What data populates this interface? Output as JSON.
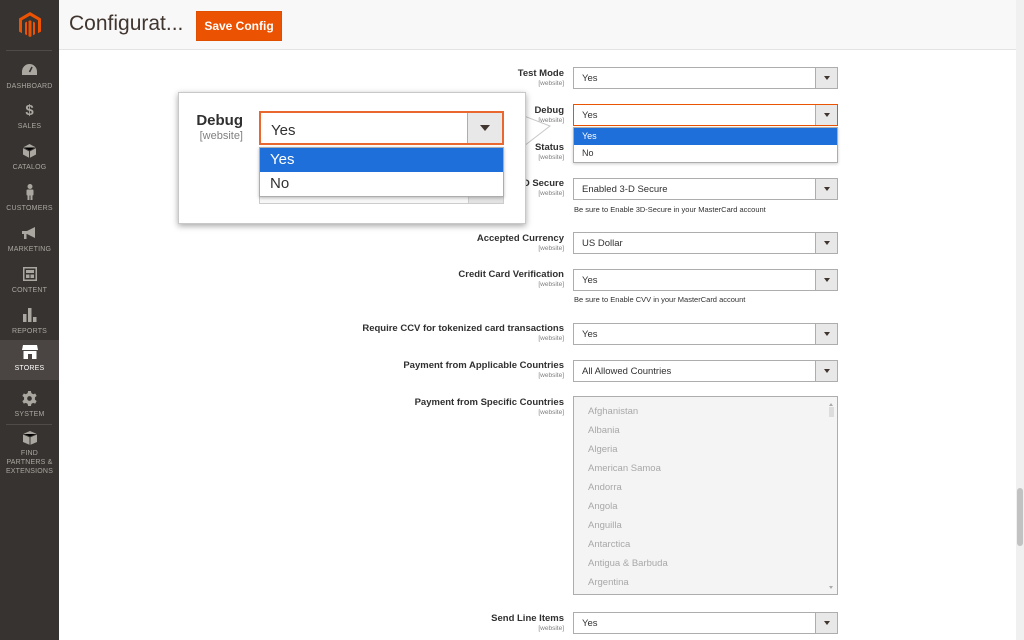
{
  "sidebar": {
    "items": [
      {
        "label": "DASHBOARD",
        "icon": "dashboard-icon"
      },
      {
        "label": "SALES",
        "icon": "dollar-icon"
      },
      {
        "label": "CATALOG",
        "icon": "cube-icon"
      },
      {
        "label": "CUSTOMERS",
        "icon": "person-icon"
      },
      {
        "label": "MARKETING",
        "icon": "megaphone-icon"
      },
      {
        "label": "CONTENT",
        "icon": "layout-icon"
      },
      {
        "label": "REPORTS",
        "icon": "bar-chart-icon"
      },
      {
        "label": "STORES",
        "icon": "storefront-icon"
      },
      {
        "label": "SYSTEM",
        "icon": "gear-icon"
      },
      {
        "label": "FIND PARTNERS & EXTENSIONS",
        "icon": "box-icon"
      }
    ],
    "active": "STORES"
  },
  "header": {
    "title": "Configurat...",
    "save_label": "Save Config"
  },
  "form": {
    "test_mode": {
      "label": "Test Mode",
      "scope": "[website]",
      "value": "Yes"
    },
    "debug": {
      "label": "Debug",
      "scope": "[website]",
      "value": "Yes",
      "options": [
        "Yes",
        "No"
      ],
      "selected_option": "Yes"
    },
    "order_status": {
      "label": "Status",
      "scope": "[website]"
    },
    "secure_3d": {
      "label": "D Secure",
      "scope": "[website]",
      "value": "Enabled 3-D Secure",
      "note": "Be sure to Enable 3D-Secure in your MasterCard account"
    },
    "currency": {
      "label": "Accepted Currency",
      "scope": "[website]",
      "value": "US Dollar"
    },
    "cc_verification": {
      "label": "Credit Card Verification",
      "scope": "[website]",
      "value": "Yes",
      "note": "Be sure to Enable CVV in your MasterCard account"
    },
    "ccv_tokenized": {
      "label": "Require CCV for tokenized card transactions",
      "scope": "[website]",
      "value": "Yes"
    },
    "applicable_countries": {
      "label": "Payment from Applicable Countries",
      "scope": "[website]",
      "value": "All Allowed Countries"
    },
    "specific_countries": {
      "label": "Payment from Specific Countries",
      "scope": "[website]",
      "countries": [
        "Afghanistan",
        "Albania",
        "Algeria",
        "American Samoa",
        "Andorra",
        "Angola",
        "Anguilla",
        "Antarctica",
        "Antigua & Barbuda",
        "Argentina"
      ]
    },
    "send_line_items": {
      "label": "Send Line Items",
      "scope": "[website]",
      "value": "Yes"
    }
  },
  "callout": {
    "label": "Debug",
    "scope": "[website]",
    "value": "Yes",
    "options": [
      "Yes",
      "No"
    ],
    "selected_option": "Yes"
  },
  "colors": {
    "accent": "#eb5202",
    "sidebar": "#373330",
    "selected": "#1e6fd9"
  }
}
